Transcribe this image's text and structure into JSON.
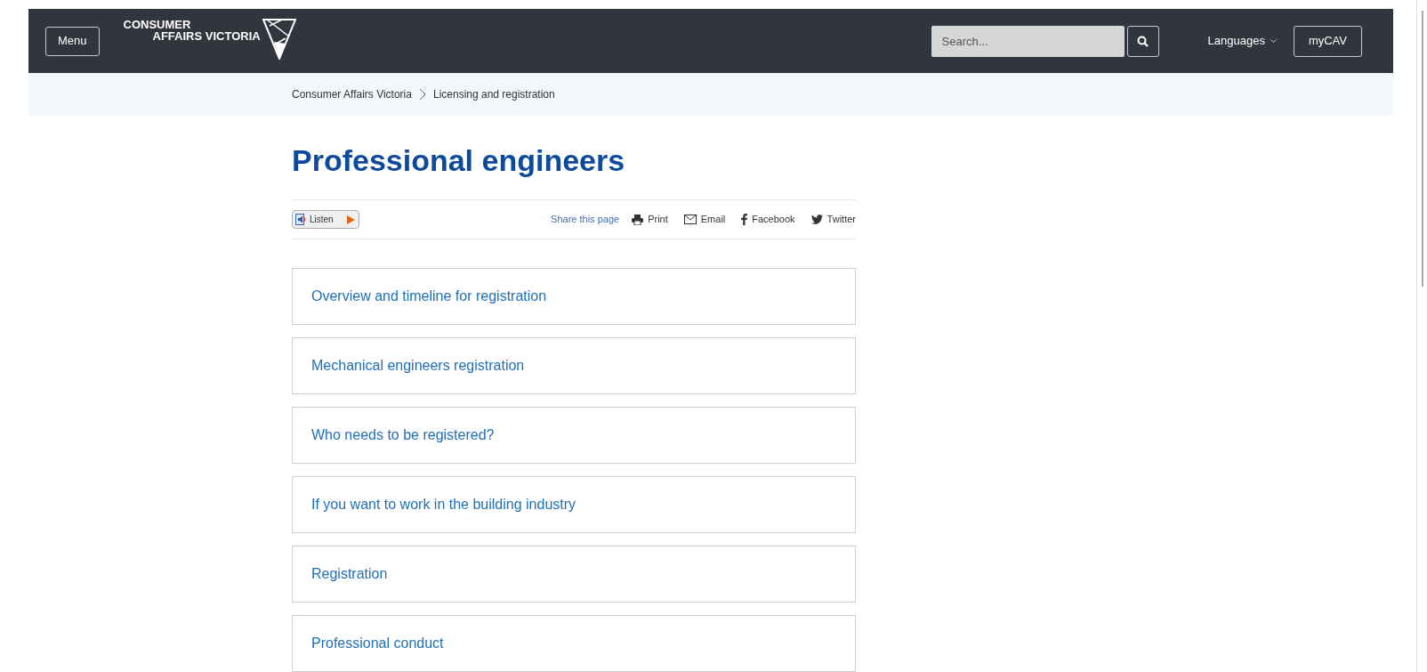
{
  "header": {
    "menu_button": "Menu",
    "logo": {
      "line_1": "CONSUMER",
      "line_2": "AFFAIRS VICTORIA"
    },
    "search": {
      "placeholder": "Search..."
    },
    "languages": "Languages",
    "mycav": "myCAV"
  },
  "breadcrumb": [
    "Consumer Affairs Victoria",
    "Licensing and registration"
  ],
  "title": "Professional engineers",
  "toolbar": {
    "listen": "Listen",
    "share_label": "Share this page",
    "actions": [
      {
        "kind": "print",
        "label": "Print"
      },
      {
        "kind": "email",
        "label": "Email"
      },
      {
        "kind": "facebook",
        "label": "Facebook"
      },
      {
        "kind": "twitter",
        "label": "Twitter"
      }
    ]
  },
  "sections": [
    {
      "label": "Overview and timeline for registration"
    },
    {
      "label": "Mechanical engineers registration"
    },
    {
      "label": "Who needs to be registered?"
    },
    {
      "label": "If you want to work in the building industry"
    },
    {
      "label": "Registration"
    },
    {
      "label": "Professional conduct"
    }
  ]
}
